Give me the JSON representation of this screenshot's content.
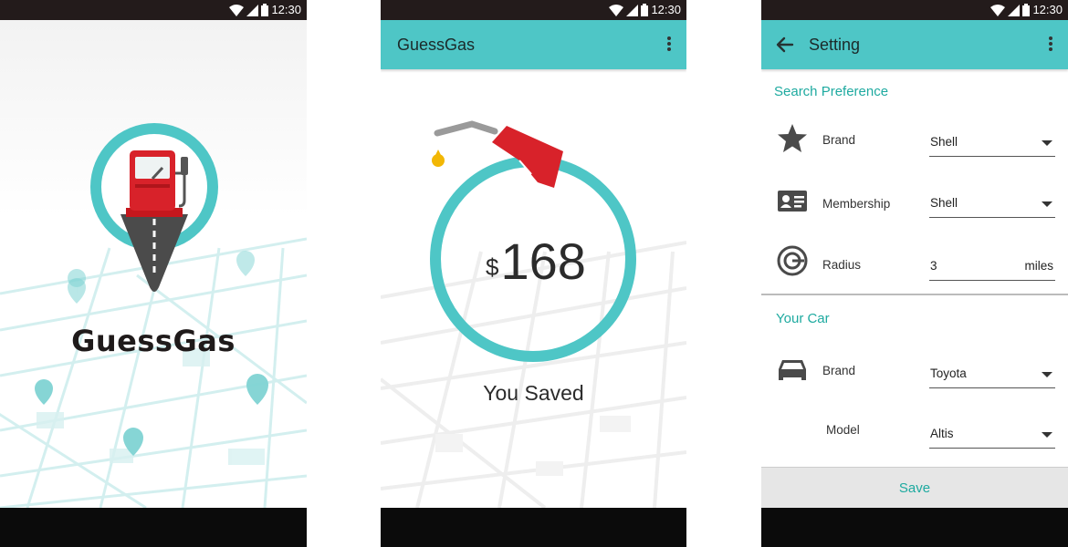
{
  "status_bar": {
    "time": "12:30"
  },
  "splash": {
    "app_name": "GuessGas"
  },
  "savings": {
    "app_title": "GuessGas",
    "currency": "$",
    "amount": "168",
    "caption": "You Saved"
  },
  "settings": {
    "title": "Setting",
    "search_preference": {
      "heading": "Search Preference",
      "brand": {
        "label": "Brand",
        "value": "Shell"
      },
      "membership": {
        "label": "Membership",
        "value": "Shell"
      },
      "radius": {
        "label": "Radius",
        "value": "3",
        "unit": "miles"
      }
    },
    "your_car": {
      "heading": "Your Car",
      "brand": {
        "label": "Brand",
        "value": "Toyota"
      },
      "model": {
        "label": "Model",
        "value": "Altis"
      }
    },
    "save_label": "Save"
  },
  "colors": {
    "accent": "#4ec6c6",
    "accent_text": "#1eaaa0",
    "pump_red": "#d8222a",
    "status_bar": "#231b1b"
  }
}
